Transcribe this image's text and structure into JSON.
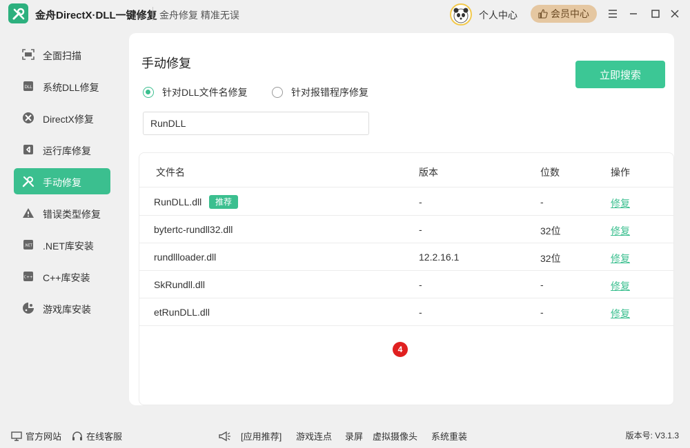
{
  "titlebar": {
    "app_title": "金舟DirectX·DLL一键修复",
    "slogan": "金舟修复 精准无误",
    "user_center": "个人中心",
    "vip_label": "会员中心"
  },
  "sidebar": {
    "items": [
      {
        "label": "全面扫描",
        "icon": "scan-icon"
      },
      {
        "label": "系统DLL修复",
        "icon": "dll-icon"
      },
      {
        "label": "DirectX修复",
        "icon": "directx-icon"
      },
      {
        "label": "运行库修复",
        "icon": "vs-icon"
      },
      {
        "label": "手动修复",
        "icon": "wrench-icon",
        "active": true
      },
      {
        "label": "错误类型修复",
        "icon": "warning-icon"
      },
      {
        "label": ".NET库安装",
        "icon": "dotnet-icon"
      },
      {
        "label": "C++库安装",
        "icon": "cpp-icon"
      },
      {
        "label": "游戏库安装",
        "icon": "game-icon"
      }
    ]
  },
  "main": {
    "title": "手动修复",
    "search_button": "立即搜索",
    "radio_options": [
      {
        "label": "针对DLL文件名修复",
        "checked": true
      },
      {
        "label": "针对报错程序修复",
        "checked": false
      }
    ],
    "search_value": "RunDLL",
    "table": {
      "headers": [
        "文件名",
        "版本",
        "位数",
        "操作"
      ],
      "rows": [
        {
          "name": "RunDLL.dll",
          "tag": "推荐",
          "version": "-",
          "bits": "-",
          "action": "修复"
        },
        {
          "name": "bytertc-rundll32.dll",
          "version": "-",
          "bits": "32位",
          "action": "修复"
        },
        {
          "name": "rundllloader.dll",
          "version": "12.2.16.1",
          "bits": "32位",
          "action": "修复"
        },
        {
          "name": "SkRundll.dll",
          "version": "-",
          "bits": "-",
          "action": "修复"
        },
        {
          "name": "etRunDLL.dll",
          "version": "-",
          "bits": "-",
          "action": "修复"
        }
      ]
    },
    "badge_count": "4"
  },
  "footer": {
    "official_site": "官方网站",
    "online_service": "在线客服",
    "app_recommend": "[应用推荐]",
    "links": [
      "游戏连点",
      "录屏",
      "虚拟摄像头",
      "系统重装"
    ],
    "version": "版本号: V3.1.3"
  },
  "colors": {
    "accent": "#3bbf8f",
    "vip_bg": "#e5c7a1",
    "badge": "#e02020"
  }
}
